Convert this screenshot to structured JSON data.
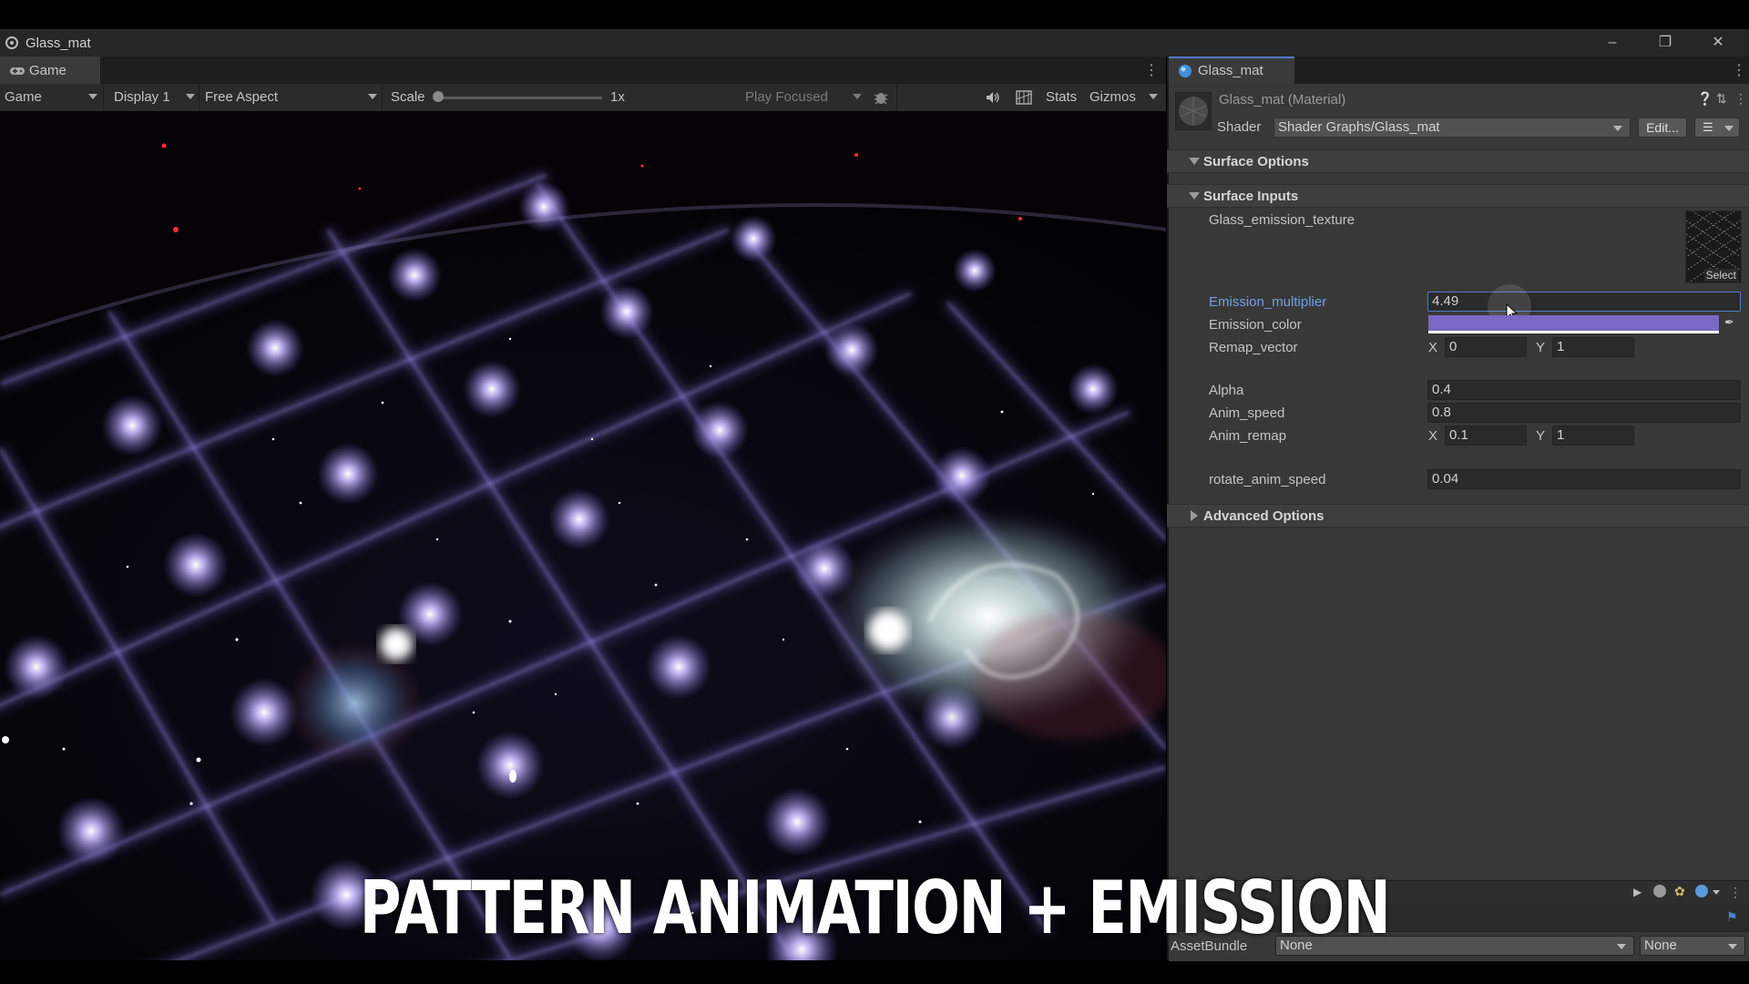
{
  "window": {
    "title": "Glass_mat",
    "controls": [
      "minimize-icon",
      "restore-icon",
      "close-icon"
    ]
  },
  "game": {
    "tab_label": "Game",
    "toolbar": {
      "view_mode": "Game",
      "display": "Display 1",
      "aspect": "Free Aspect",
      "scale_label": "Scale",
      "scale_value": "1x",
      "play_mode": "Play Focused",
      "stats": "Stats",
      "gizmos": "Gizmos"
    }
  },
  "inspector": {
    "tab_label": "Glass_mat",
    "header_name": "Glass_mat (Material)",
    "shader_label": "Shader",
    "shader_value": "Shader Graphs/Glass_mat",
    "edit_button": "Edit...",
    "sections": {
      "surface_options": "Surface Options",
      "surface_inputs": "Surface Inputs",
      "advanced_options": "Advanced Options"
    },
    "texture": {
      "label": "Glass_emission_texture",
      "select_label": "Select"
    },
    "properties": {
      "emission_multiplier": {
        "label": "Emission_multiplier",
        "value": "4.49"
      },
      "emission_color": {
        "label": "Emission_color",
        "color": "#7a68c4"
      },
      "remap_vector": {
        "label": "Remap_vector",
        "x_label": "X",
        "x": "0",
        "y_label": "Y",
        "y": "1"
      },
      "alpha": {
        "label": "Alpha",
        "value": "0.4"
      },
      "anim_speed": {
        "label": "Anim_speed",
        "value": "0.8"
      },
      "anim_remap": {
        "label": "Anim_remap",
        "x_label": "X",
        "x": "0.1",
        "y_label": "Y",
        "y": "1"
      },
      "rotate_anim_speed": {
        "label": "rotate_anim_speed",
        "value": "0.04"
      }
    },
    "asset_bundle": {
      "label": "AssetBundle",
      "value": "None",
      "variant": "None"
    }
  },
  "caption": "PATTERN ANIMATION + EMISSION",
  "colors": {
    "accent_blue": "#4c7cc9",
    "inspector_bg": "#383838",
    "toolbar_bg": "#2b2b2b",
    "emission": "#7a68c4"
  }
}
